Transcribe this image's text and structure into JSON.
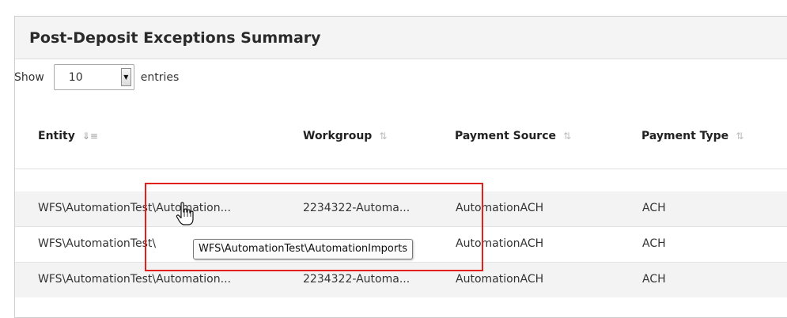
{
  "panel": {
    "title": "Post-Deposit Exceptions Summary"
  },
  "length": {
    "show_label": "Show",
    "value": "10",
    "entries_label": "entries"
  },
  "columns": [
    {
      "label": "Entity",
      "sort_icon": "sort-asc-icon",
      "active": true
    },
    {
      "label": "Workgroup",
      "sort_icon": "sort-both-icon",
      "active": false
    },
    {
      "label": "Payment Source",
      "sort_icon": "sort-both-icon",
      "active": false
    },
    {
      "label": "Payment Type",
      "sort_icon": "sort-both-icon",
      "active": false
    }
  ],
  "rows": [
    {
      "entity": "WFS\\AutomationTest\\Automation...",
      "workgroup": "2234322-Automa...",
      "payment_source": "AutomationACH",
      "payment_type": "ACH"
    },
    {
      "entity": "WFS\\AutomationTest\\",
      "workgroup": "",
      "payment_source": "AutomationACH",
      "payment_type": "ACH"
    },
    {
      "entity": "WFS\\AutomationTest\\Automation...",
      "workgroup": "2234322-Automa...",
      "payment_source": "AutomationACH",
      "payment_type": "ACH"
    }
  ],
  "tooltip": {
    "text": "WFS\\AutomationTest\\AutomationImports"
  },
  "colors": {
    "highlight": "#e2211c",
    "row_stripe": "#f3f3f3",
    "header_bg": "#f4f4f4"
  },
  "icons": {
    "cursor": "hand-pointer-icon",
    "dropdown": "chevron-down-icon"
  }
}
